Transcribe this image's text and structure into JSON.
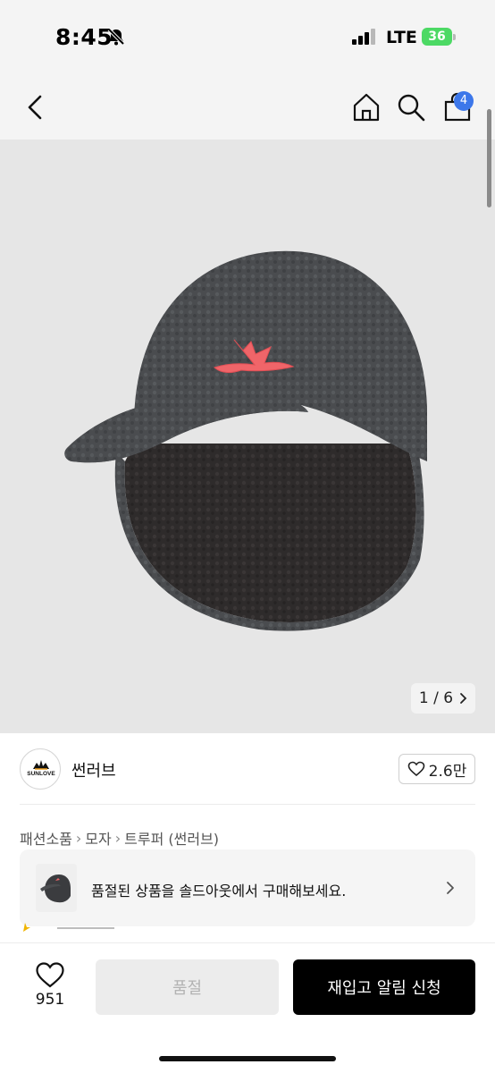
{
  "status_bar": {
    "time": "8:45",
    "network": "LTE",
    "battery": "36",
    "icons": [
      "bell-slash-icon",
      "signal-icon",
      "battery-icon"
    ]
  },
  "nav": {
    "cart_count": "4",
    "icons": [
      "back-arrow-icon",
      "home-icon",
      "search-icon",
      "shopping-bag-icon"
    ]
  },
  "gallery": {
    "pager": "1 / 6"
  },
  "brand": {
    "name": "썬러브",
    "logo_text": "SUNLOVE",
    "likes": "2.6만"
  },
  "breadcrumb": {
    "items": [
      "패션소품",
      "모자",
      "트루퍼 (썬러브)"
    ]
  },
  "banner": {
    "text": "품절된 상품을 솔드아웃에서 구매해보세요."
  },
  "actions": {
    "wish_count": "951",
    "soldout_label": "품절",
    "restock_label": "재입고 알림 신청"
  },
  "colors": {
    "accent": "#3c77ea",
    "primary_button": "#000000",
    "disabled_button": "#ececec",
    "logo_orange": "#f0a01c"
  }
}
